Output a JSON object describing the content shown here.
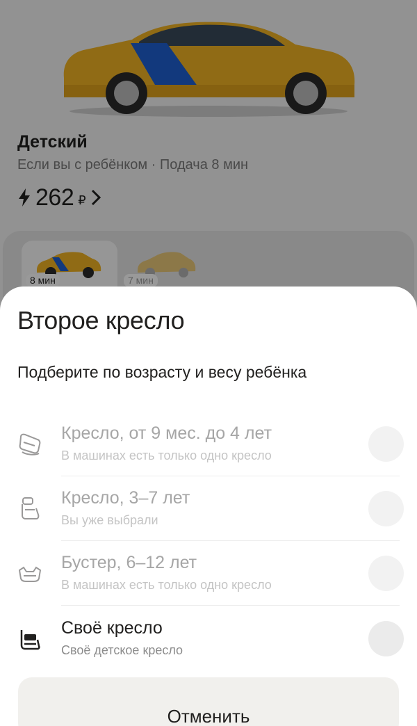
{
  "background": {
    "tariff": {
      "title": "Детский",
      "subtitle": "Если вы с ребёнком · Подача 8 мин",
      "price": "262",
      "currency": "₽"
    },
    "tariff_cards": [
      {
        "eta": "8 мин"
      },
      {
        "eta": "7 мин"
      }
    ]
  },
  "sheet": {
    "title": "Второе кресло",
    "subtitle": "Подберите по возрасту и весу ребёнка",
    "options": [
      {
        "title": "Кресло, от 9 мес. до 4 лет",
        "subtitle": "В машинах есть только одно кресло",
        "icon": "infant-seat-icon"
      },
      {
        "title": "Кресло, 3–7 лет",
        "subtitle": "Вы уже выбрали",
        "icon": "child-seat-icon"
      },
      {
        "title": "Бустер, 6–12 лет",
        "subtitle": "В машинах есть только одно кресло",
        "icon": "booster-icon"
      },
      {
        "title": "Своё кресло",
        "subtitle": "Своё детское кресло",
        "icon": "own-seat-icon"
      }
    ],
    "cancel_label": "Отменить"
  },
  "colors": {
    "taxi_yellow": "#f4b92a",
    "brand_blue": "#1e5fd0",
    "text_primary": "#21201f"
  }
}
